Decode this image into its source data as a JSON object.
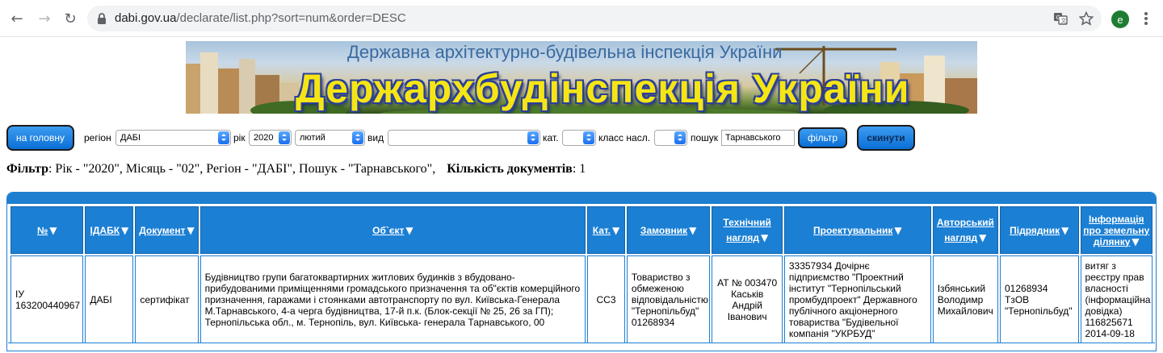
{
  "browser": {
    "url_host": "dabi.gov.ua",
    "url_path": "/declarate/list.php?sort=num&order=DESC",
    "avatar_letter": "e"
  },
  "banner": {
    "subtitle": "Державна архітектурно-будівельна інспекція України",
    "title": "Держархбудінспекція України"
  },
  "filters": {
    "home_button": "на головну",
    "region_label": "регіон",
    "region_value": "ДАБІ",
    "year_label": "рік",
    "year_value": "2020",
    "month_value": "лютий",
    "type_label": "вид",
    "type_value": "",
    "cat_label": "кат.",
    "cat_value": "",
    "class_label": "класс насл.",
    "class_value": "",
    "search_label": "пошук",
    "search_value": "Тарнавського",
    "filter_button": "фільтр",
    "reset_button": "скинути"
  },
  "summary": {
    "filter_label": "Фільтр",
    "filter_text": ": Рік - \"2020\", Місяць - \"02\", Регіон - \"ДАБІ\", Пошук - \"Тарнавського\",",
    "count_label": "Кількість документів",
    "count_value": ": 1"
  },
  "table": {
    "columns": [
      "№",
      "ІДАБК",
      "Документ",
      "Об`єкт",
      "Кат.",
      "Замовник",
      "Технічний нагляд",
      "Проектувальник",
      "Авторський нагляд",
      "Підрядник",
      "Інформація про земельну ділянку"
    ],
    "rows": [
      {
        "num": "ІУ 163200440967",
        "idabk": "ДАБІ",
        "doc": "сертифікат",
        "object": "Будівництво групи багатоквартирних житлових будинків з вбудовано-прибудованими приміщеннями громадського призначення та об\"єктів комерційного призначення, гаражами і стоянками автотранспорту по вул. Київська-Генерала М.Тарнавського, 4-а черга будівництва, 17-й п.к. (Блок-секції № 25, 26 за ГП); Тернопільська обл., м. Тернопіль, вул. Київська- генерала Тарнавського, 00",
        "cat": "СС3",
        "customer": "Товариство з обмеженою відповідальністю \"Тернопільбуд\" 01268934",
        "tech": "АТ № 003470 Каськів Андрій Іванович",
        "designer": "33357934 Дочірнє підприємство \"Проектний інститут \"Тернопільський промбудпроект\" Державного публічного акціонерного товариства \"Будівельної компанія \"УКРБУД\"",
        "author": "Ізбянський Володимр Михайлович",
        "contractor": "01268934 ТзОВ \"Тернопільбуд\"",
        "land": "витяг з реєстру прав власності (інформаційна довідка) 116825671 2014-09-18"
      }
    ]
  }
}
